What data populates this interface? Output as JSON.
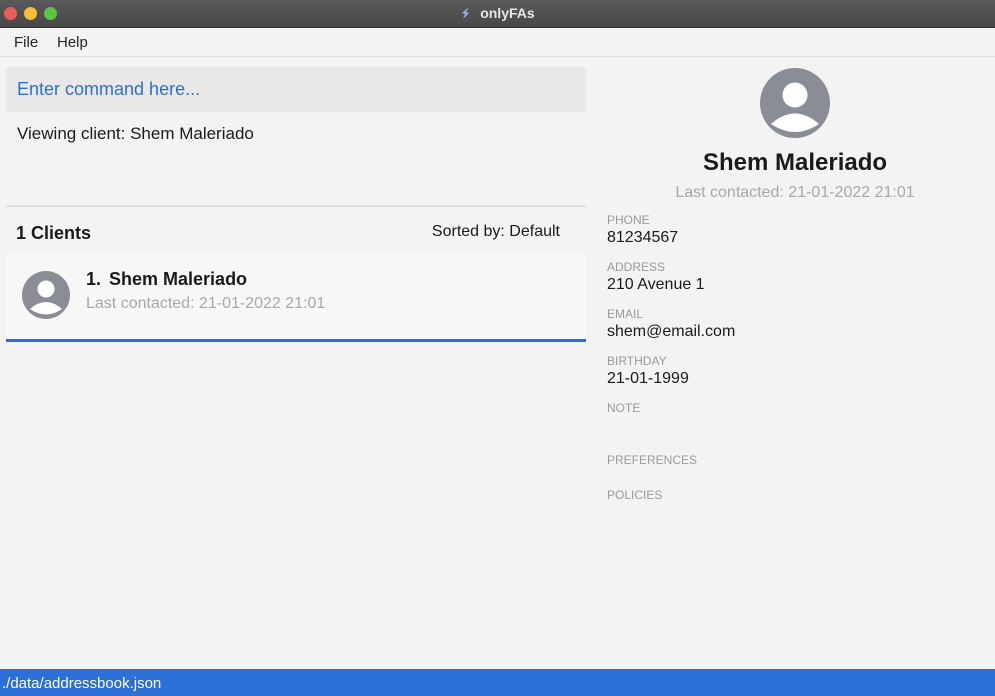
{
  "window": {
    "title": "onlyFAs",
    "colors": {
      "accent": "#2c6fd6",
      "close": "#ee5d55",
      "minimize": "#f4bd3a",
      "maximize": "#5fc443"
    }
  },
  "menu": {
    "file": "File",
    "help": "Help"
  },
  "command": {
    "placeholder": "Enter command here..."
  },
  "result": {
    "text": "Viewing client: Shem Maleriado"
  },
  "client_list": {
    "header": "1 Clients",
    "sort": "Sorted by: Default",
    "items": [
      {
        "index": "1.",
        "name": "Shem Maleriado",
        "last_contacted": "Last contacted: 21-01-2022 21:01",
        "avatar_icon": "user-avatar-icon"
      }
    ]
  },
  "detail": {
    "avatar_icon": "user-avatar-icon",
    "name": "Shem Maleriado",
    "last_contacted": "Last contacted: 21-01-2022 21:01",
    "fields": {
      "phone_label": "PHONE",
      "phone": "81234567",
      "address_label": "ADDRESS",
      "address": "210 Avenue 1",
      "email_label": "EMAIL",
      "email": "shem@email.com",
      "birthday_label": "BIRTHDAY",
      "birthday": "21-01-1999",
      "note_label": "NOTE",
      "preferences_label": "PREFERENCES",
      "policies_label": "POLICIES"
    }
  },
  "status": {
    "path": "./data/addressbook.json"
  }
}
